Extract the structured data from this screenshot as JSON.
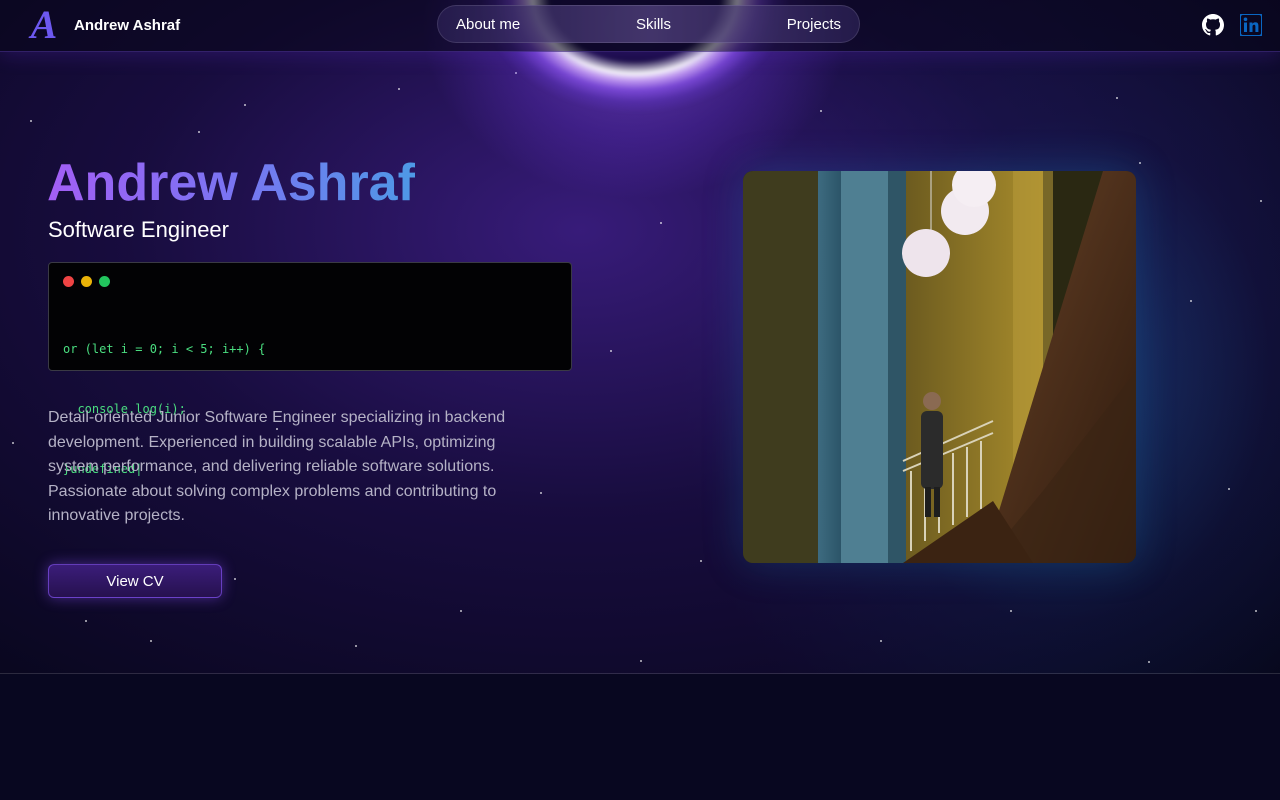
{
  "header": {
    "brand_mark": "A",
    "brand_name": "Andrew Ashraf",
    "nav": [
      {
        "label": "About me"
      },
      {
        "label": "Skills"
      },
      {
        "label": "Projects"
      }
    ],
    "social": [
      {
        "icon": "github-icon"
      },
      {
        "icon": "linkedin-icon"
      }
    ]
  },
  "hero": {
    "name": "Andrew Ashraf",
    "role": "Software Engineer",
    "code_lines": [
      "or (let i = 0; i < 5; i++) {",
      "  console.log(i);",
      "}undefined|"
    ],
    "bio": "Detail-oriented Junior Software Engineer specializing in backend development. Experienced in building scalable APIs, optimizing system performance, and delivering reliable software solutions. Passionate about solving complex problems and contributing to innovative projects.",
    "cv_button": "View CV"
  },
  "colors": {
    "accent_purple": "#a35ef5",
    "accent_blue": "#4e99e6",
    "code_green": "#4ade80",
    "background": "#07061a",
    "linkedin": "#0a66c2"
  }
}
